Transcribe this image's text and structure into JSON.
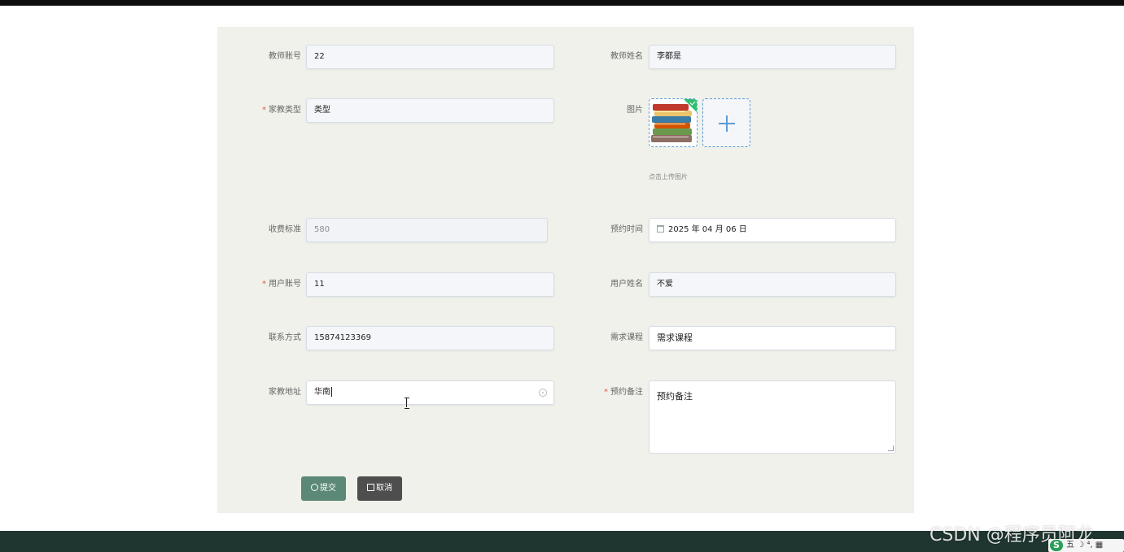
{
  "form": {
    "teacher_account": {
      "label": "教师账号",
      "value": "22",
      "required": false
    },
    "teacher_name": {
      "label": "教师姓名",
      "value": "李都是",
      "required": false
    },
    "tutor_type": {
      "label": "家教类型",
      "value": "类型",
      "required": true
    },
    "image": {
      "label": "图片",
      "hint": "点击上传图片"
    },
    "fee_standard": {
      "label": "收费标准",
      "value": "580",
      "required": false
    },
    "booking_time": {
      "label": "预约时间",
      "value": "2025 年 04 月 06 日",
      "required": false
    },
    "user_account": {
      "label": "用户账号",
      "value": "11",
      "required": true
    },
    "user_name": {
      "label": "用户姓名",
      "value": "不爱",
      "required": false
    },
    "contact": {
      "label": "联系方式",
      "value": "15874123369",
      "required": false
    },
    "course": {
      "label": "需求课程",
      "value": "需求课程",
      "required": false
    },
    "address": {
      "label": "家教地址",
      "value": "华南",
      "required": false
    },
    "remark": {
      "label": "预约备注",
      "value": "预约备注",
      "required": true
    },
    "required_mark": "*"
  },
  "buttons": {
    "submit": "提交",
    "cancel": "取消"
  },
  "watermark": "CSDN @程序员阿龙",
  "ime": {
    "logo": "S",
    "text": "五 ☽ ⁴, ▦"
  },
  "colors": {
    "panel": "#eff1ea",
    "submit": "#5b8877",
    "cancel": "#4e4e4e",
    "footer": "#1f3530",
    "required": "#e15a4e",
    "upload_border": "#5b9bd5"
  }
}
